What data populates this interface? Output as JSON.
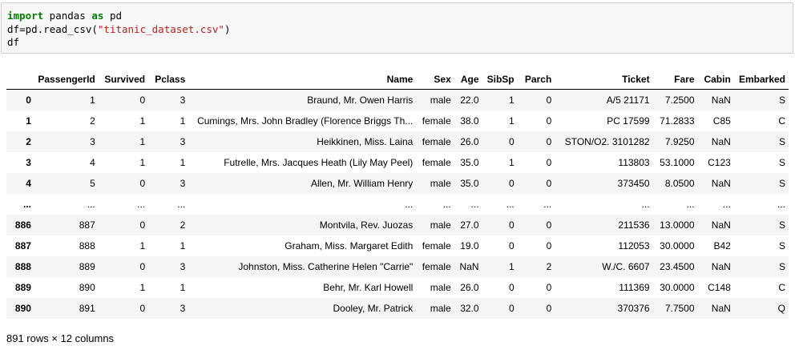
{
  "code_cell": {
    "lines": [
      [
        {
          "t": "import",
          "c": "kw"
        },
        {
          "t": " pandas ",
          "c": ""
        },
        {
          "t": "as",
          "c": "kw"
        },
        {
          "t": " pd",
          "c": ""
        }
      ],
      [
        {
          "t": "df",
          "c": ""
        },
        {
          "t": "=",
          "c": ""
        },
        {
          "t": "pd.read_csv(",
          "c": ""
        },
        {
          "t": "\"titanic_dataset.csv\"",
          "c": "str"
        },
        {
          "t": ")",
          "c": ""
        }
      ],
      [
        {
          "t": "df",
          "c": ""
        }
      ]
    ]
  },
  "dataframe": {
    "columns": [
      "",
      "PassengerId",
      "Survived",
      "Pclass",
      "Name",
      "Sex",
      "Age",
      "SibSp",
      "Parch",
      "Ticket",
      "Fare",
      "Cabin",
      "Embarked"
    ],
    "rows": [
      [
        "0",
        "1",
        "0",
        "3",
        "Braund, Mr. Owen Harris",
        "male",
        "22.0",
        "1",
        "0",
        "A/5 21171",
        "7.2500",
        "NaN",
        "S"
      ],
      [
        "1",
        "2",
        "1",
        "1",
        "Cumings, Mrs. John Bradley (Florence Briggs Th...",
        "female",
        "38.0",
        "1",
        "0",
        "PC 17599",
        "71.2833",
        "C85",
        "C"
      ],
      [
        "2",
        "3",
        "1",
        "3",
        "Heikkinen, Miss. Laina",
        "female",
        "26.0",
        "0",
        "0",
        "STON/O2. 3101282",
        "7.9250",
        "NaN",
        "S"
      ],
      [
        "3",
        "4",
        "1",
        "1",
        "Futrelle, Mrs. Jacques Heath (Lily May Peel)",
        "female",
        "35.0",
        "1",
        "0",
        "113803",
        "53.1000",
        "C123",
        "S"
      ],
      [
        "4",
        "5",
        "0",
        "3",
        "Allen, Mr. William Henry",
        "male",
        "35.0",
        "0",
        "0",
        "373450",
        "8.0500",
        "NaN",
        "S"
      ],
      [
        "...",
        "...",
        "...",
        "...",
        "...",
        "...",
        "...",
        "...",
        "...",
        "...",
        "...",
        "...",
        "..."
      ],
      [
        "886",
        "887",
        "0",
        "2",
        "Montvila, Rev. Juozas",
        "male",
        "27.0",
        "0",
        "0",
        "211536",
        "13.0000",
        "NaN",
        "S"
      ],
      [
        "887",
        "888",
        "1",
        "1",
        "Graham, Miss. Margaret Edith",
        "female",
        "19.0",
        "0",
        "0",
        "112053",
        "30.0000",
        "B42",
        "S"
      ],
      [
        "888",
        "889",
        "0",
        "3",
        "Johnston, Miss. Catherine Helen \"Carrie\"",
        "female",
        "NaN",
        "1",
        "2",
        "W./C. 6607",
        "23.4500",
        "NaN",
        "S"
      ],
      [
        "889",
        "890",
        "1",
        "1",
        "Behr, Mr. Karl Howell",
        "male",
        "26.0",
        "0",
        "0",
        "111369",
        "30.0000",
        "C148",
        "C"
      ],
      [
        "890",
        "891",
        "0",
        "3",
        "Dooley, Mr. Patrick",
        "male",
        "32.0",
        "0",
        "0",
        "370376",
        "7.7500",
        "NaN",
        "Q"
      ]
    ],
    "shape_text": "891 rows × 12 columns"
  }
}
